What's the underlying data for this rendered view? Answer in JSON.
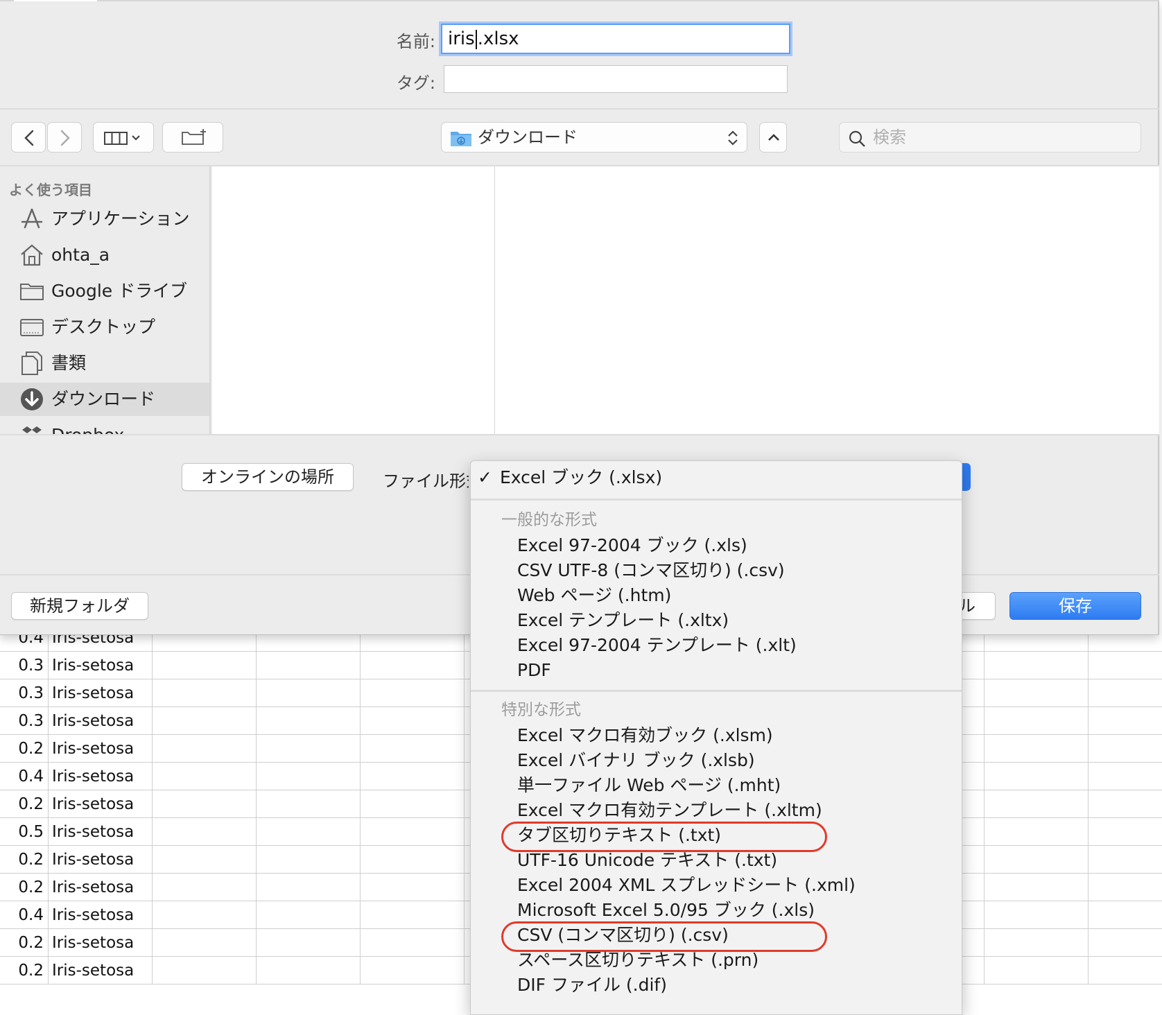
{
  "sheet": {
    "rows": [
      {
        "num": "0.4",
        "species": "Iris-setosa"
      },
      {
        "num": "0.3",
        "species": "Iris-setosa"
      },
      {
        "num": "0.3",
        "species": "Iris-setosa"
      },
      {
        "num": "0.3",
        "species": "Iris-setosa"
      },
      {
        "num": "0.2",
        "species": "Iris-setosa"
      },
      {
        "num": "0.4",
        "species": "Iris-setosa"
      },
      {
        "num": "0.2",
        "species": "Iris-setosa"
      },
      {
        "num": "0.5",
        "species": "Iris-setosa"
      },
      {
        "num": "0.2",
        "species": "Iris-setosa"
      },
      {
        "num": "0.2",
        "species": "Iris-setosa"
      },
      {
        "num": "0.4",
        "species": "Iris-setosa"
      },
      {
        "num": "0.2",
        "species": "Iris-setosa"
      },
      {
        "num": "0.2",
        "species": "Iris-setosa"
      }
    ]
  },
  "dialog": {
    "name_label": "名前:",
    "name_before_caret": "iris",
    "name_after_caret": ".xlsx",
    "tag_label": "タグ:",
    "tag_value": "",
    "location": "ダウンロード",
    "search_placeholder": "検索",
    "accent_color": "#2e7cf2"
  },
  "sidebar": {
    "heading": "よく使う項目",
    "items": [
      {
        "label": "アプリケーション",
        "icon": "applications-icon"
      },
      {
        "label": "ohta_a",
        "icon": "home-icon"
      },
      {
        "label": "Google ドライブ",
        "icon": "folder-icon"
      },
      {
        "label": "デスクトップ",
        "icon": "desktop-icon"
      },
      {
        "label": "書類",
        "icon": "documents-icon"
      },
      {
        "label": "ダウンロード",
        "icon": "download-icon",
        "selected": true
      },
      {
        "label": "Dropbox",
        "icon": "dropbox-icon"
      }
    ]
  },
  "bottom": {
    "online_button": "オンラインの場所",
    "format_label": "ファイル形式",
    "new_folder": "新規フォルダ",
    "cancel_partial": "ル",
    "save": "保存"
  },
  "menu": {
    "checked_item": "Excel ブック (.xlsx)",
    "common_header": "一般的な形式",
    "common_items": [
      "Excel 97-2004 ブック (.xls)",
      "CSV UTF-8 (コンマ区切り) (.csv)",
      "Web ページ (.htm)",
      "Excel テンプレート (.xltx)",
      "Excel 97-2004 テンプレート (.xlt)",
      "PDF"
    ],
    "special_header": "特別な形式",
    "special_items": [
      "Excel マクロ有効ブック (.xlsm)",
      "Excel バイナリ ブック (.xlsb)",
      "単一ファイル Web ページ (.mht)",
      "Excel マクロ有効テンプレート (.xltm)",
      "タブ区切りテキスト (.txt)",
      "UTF-16 Unicode テキスト (.txt)",
      "Excel 2004 XML スプレッドシート (.xml)",
      "Microsoft Excel 5.0/95 ブック (.xls)",
      "CSV (コンマ区切り) (.csv)",
      "スペース区切りテキスト (.prn)",
      "DIF ファイル (.dif)"
    ],
    "highlight_color": "#e03a2a"
  }
}
